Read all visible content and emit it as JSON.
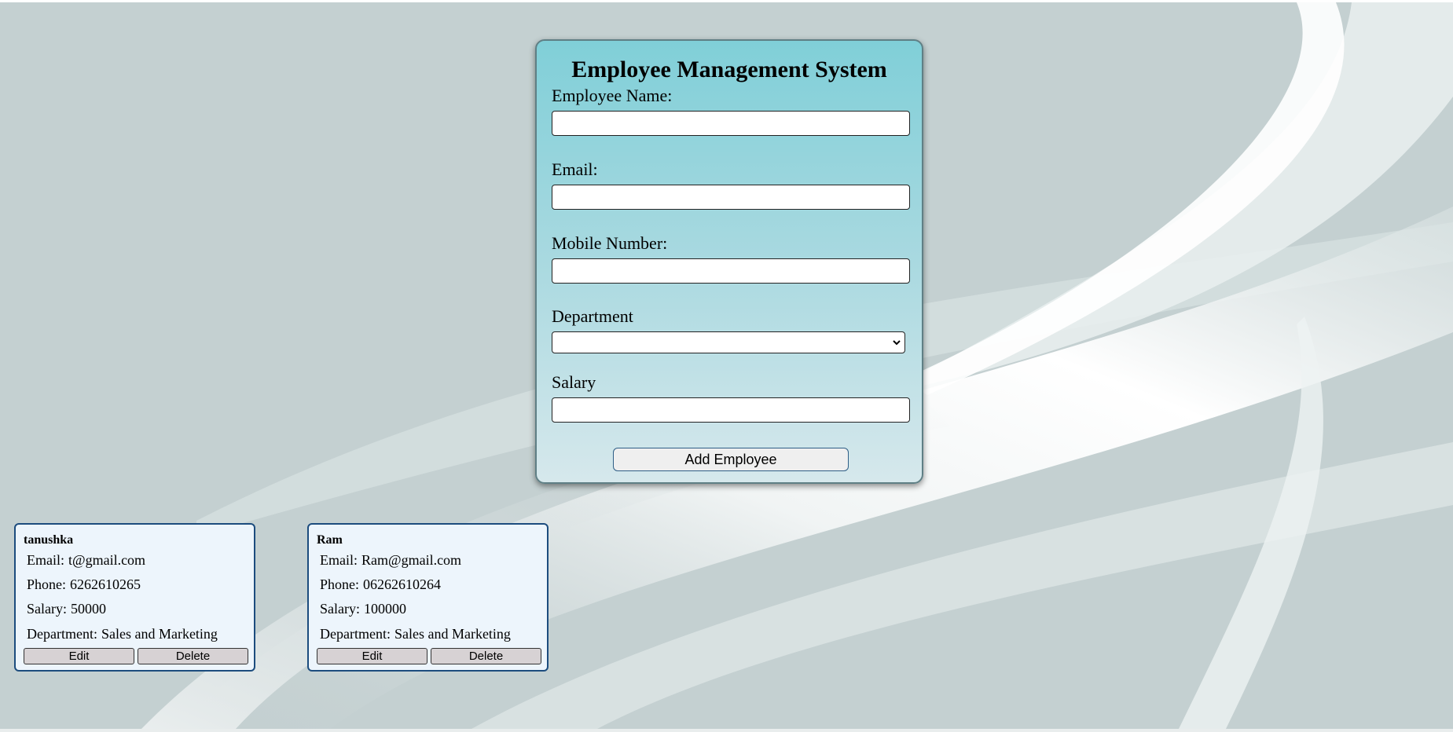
{
  "form": {
    "title": "Employee Management System",
    "fields": {
      "name": {
        "label": "Employee Name:",
        "value": ""
      },
      "email": {
        "label": "Email:",
        "value": ""
      },
      "mobile": {
        "label": "Mobile Number:",
        "value": ""
      },
      "department": {
        "label": "Department",
        "value": ""
      },
      "salary": {
        "label": "Salary",
        "value": ""
      }
    },
    "submit_label": "Add Employee"
  },
  "employees": [
    {
      "name": "tanushka",
      "email_label": "Email:",
      "email": "t@gmail.com",
      "phone_label": "Phone:",
      "phone": "6262610265",
      "salary_label": "Salary:",
      "salary": "50000",
      "department_label": "Department:",
      "department": "Sales and Marketing",
      "edit_label": "Edit",
      "delete_label": "Delete"
    },
    {
      "name": "Ram",
      "email_label": "Email:",
      "email": "Ram@gmail.com",
      "phone_label": "Phone:",
      "phone": "06262610264",
      "salary_label": "Salary:",
      "salary": "100000",
      "department_label": "Department:",
      "department": "Sales and Marketing",
      "edit_label": "Edit",
      "delete_label": "Delete"
    }
  ],
  "colors": {
    "background": "#c4d0d1",
    "form_gradient_top": "#80cfd8",
    "form_gradient_bottom": "#d6e8ec",
    "card_border": "#1c4c7e",
    "card_background": "#edf5fc",
    "button_background": "#d7d2d4"
  }
}
